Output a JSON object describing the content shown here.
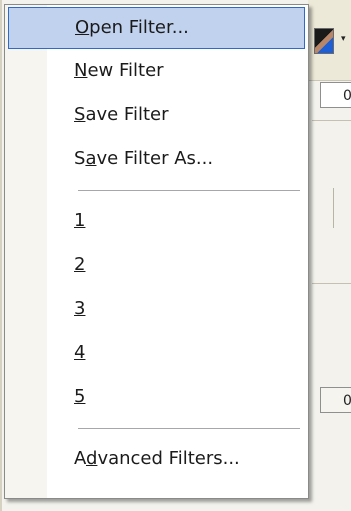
{
  "background": {
    "field_top_value": "0",
    "field_bottom_value": "0",
    "color_swatch_icon": "color-picker-icon",
    "dropdown_arrow": "▾"
  },
  "menu": {
    "highlight_color": "#c1d2ee",
    "highlight_border": "#316ac5",
    "items": [
      {
        "pre": "",
        "mn": "O",
        "post": "pen Filter...",
        "highlighted": true
      },
      {
        "pre": "",
        "mn": "N",
        "post": "ew Filter",
        "highlighted": false
      },
      {
        "pre": "",
        "mn": "S",
        "post": "ave Filter",
        "highlighted": false
      },
      {
        "pre": "S",
        "mn": "a",
        "post": "ve Filter As...",
        "highlighted": false
      },
      {
        "pre": "",
        "mn": "1",
        "post": "",
        "highlighted": false
      },
      {
        "pre": "",
        "mn": "2",
        "post": "",
        "highlighted": false
      },
      {
        "pre": "",
        "mn": "3",
        "post": "",
        "highlighted": false
      },
      {
        "pre": "",
        "mn": "4",
        "post": "",
        "highlighted": false
      },
      {
        "pre": "",
        "mn": "5",
        "post": "",
        "highlighted": false
      },
      {
        "pre": "A",
        "mn": "d",
        "post": "vanced Filters...",
        "highlighted": false
      }
    ]
  }
}
